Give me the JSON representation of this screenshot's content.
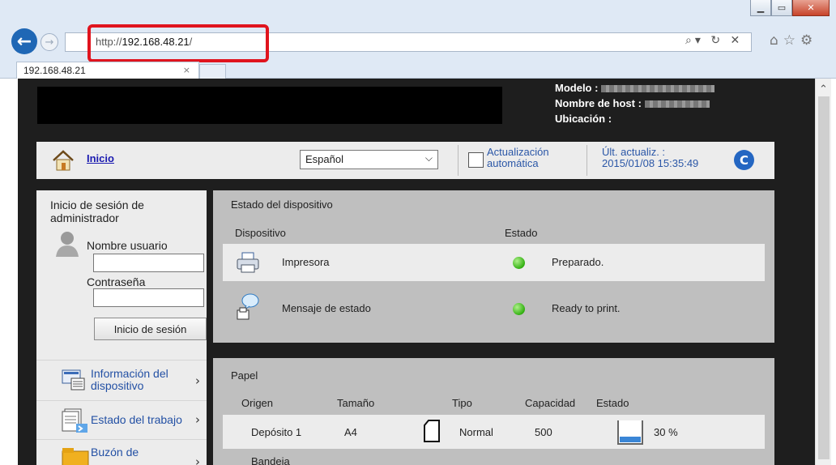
{
  "browser": {
    "url_prefix": "http://",
    "url_host": "192.168.48.21",
    "url_suffix": "/",
    "tab_title": "192.168.48.21",
    "tab_close": "×",
    "window_buttons": {
      "minimize": "▁",
      "maximize": "▭",
      "close": "✕"
    },
    "nav": {
      "back": "←",
      "forward": "→"
    },
    "addr_tools": "⌕▾ ↻ ✕",
    "right_tools": "⌂☆⚙"
  },
  "header": {
    "model_label": "Modelo :",
    "host_label": "Nombre de host :",
    "location_label": "Ubicación :"
  },
  "topbar": {
    "home_label": "Inicio",
    "language_value": "Español",
    "auto_update_label_1": "Actualización",
    "auto_update_label_2": "automática",
    "last_update_label": "Últ. actualiz. :",
    "last_update_value": "2015/01/08 15:35:49",
    "refresh_icon": "refresh-icon"
  },
  "login": {
    "title_1": "Inicio de sesión de",
    "title_2": "administrador",
    "username_label": "Nombre usuario",
    "password_label": "Contraseña",
    "button_label": "Inicio de sesión"
  },
  "menu": [
    {
      "label_1": "Información del",
      "label_2": "dispositivo"
    },
    {
      "label_1": "Estado del trabajo",
      "label_2": ""
    },
    {
      "label_1": "Buzón de",
      "label_2": ""
    }
  ],
  "device_status": {
    "title": "Estado del dispositivo",
    "col_device": "Dispositivo",
    "col_status": "Estado",
    "rows": [
      {
        "device": "Impresora",
        "status": "Preparado."
      },
      {
        "device": "Mensaje de estado",
        "status": "Ready to print."
      }
    ]
  },
  "paper": {
    "title": "Papel",
    "col_origin": "Origen",
    "col_size": "Tamaño",
    "col_type": "Tipo",
    "col_capacity": "Capacidad",
    "col_status": "Estado",
    "rows": [
      {
        "origin": "Depósito 1",
        "size": "A4",
        "type": "Normal",
        "capacity": "500",
        "level": "30 %"
      },
      {
        "origin": "Bandeja",
        "size": "",
        "type": "",
        "capacity": "",
        "level": ""
      }
    ]
  },
  "colors": {
    "accent_link": "#2350a4",
    "highlight_box": "#e0141e",
    "status_ok": "#32b011"
  }
}
